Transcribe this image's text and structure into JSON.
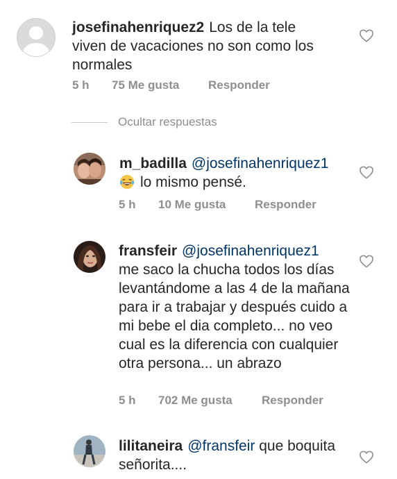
{
  "comments": [
    {
      "username": "josefinahenriquez2",
      "mention": "",
      "text": "Los de la tele viven de vacaciones no son como los normales",
      "time": "5 h",
      "likes": "75 Me gusta",
      "reply": "Responder",
      "avatar": "default-avatar"
    },
    {
      "username": "m_badilla",
      "mention": "@josefinahenriquez1",
      "text": "lo mismo pensé.",
      "emoji": "laughing-tears-emoji",
      "time": "5 h",
      "likes": "10 Me gusta",
      "reply": "Responder",
      "avatar": "photo-avatar"
    },
    {
      "username": "fransfeir",
      "mention": "@josefinahenriquez1",
      "text": "me saco la chucha todos los días levantándome a las 4 de la mañana para ir a trabajar y después cuido a mi bebe el dia completo... no veo cual es la diferencia con cualquier otra persona... un abrazo",
      "time": "5 h",
      "likes": "702 Me gusta",
      "reply": "Responder",
      "avatar": "photo-avatar"
    },
    {
      "username": "lilitaneira",
      "mention": "@fransfeir",
      "text": "que boquita señorita....",
      "avatar": "photo-avatar"
    }
  ],
  "replies_toggle": "Ocultar respuestas",
  "icons": {
    "like": "heart-outline-icon"
  },
  "colors": {
    "mention": "#003569",
    "meta": "#8e8e8e",
    "text": "#262626"
  }
}
